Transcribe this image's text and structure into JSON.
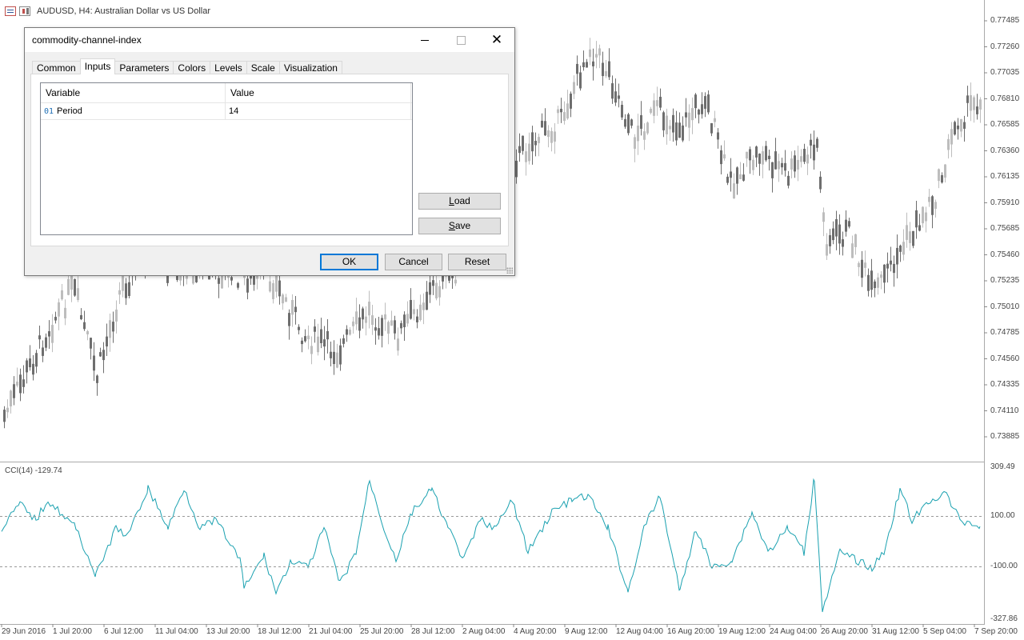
{
  "chart_window": {
    "symbol_title": "AUDUSD, H4:  Australian Dollar vs US Dollar",
    "icons": [
      "chart-window-icon",
      "candles-icon"
    ]
  },
  "indicator_window": {
    "label": "CCI(14) -129.74",
    "line_color": "#1aa1b0"
  },
  "price_axis": [
    "0.77485",
    "0.77260",
    "0.77035",
    "0.76810",
    "0.76585",
    "0.76360",
    "0.76135",
    "0.75910",
    "0.75685",
    "0.75460",
    "0.75235",
    "0.75010",
    "0.74785",
    "0.74560",
    "0.74335",
    "0.74110",
    "0.73885"
  ],
  "cci_axis": [
    "309.49",
    "100.00",
    "-100.00",
    "-327.86"
  ],
  "time_axis": [
    "29 Jun 2016",
    "1 Jul 20:00",
    "6 Jul 12:00",
    "11 Jul 04:00",
    "13 Jul 20:00",
    "18 Jul 12:00",
    "21 Jul 04:00",
    "25 Jul 20:00",
    "28 Jul 12:00",
    "2 Aug 04:00",
    "4 Aug 20:00",
    "9 Aug 12:00",
    "12 Aug 04:00",
    "16 Aug 20:00",
    "19 Aug 12:00",
    "24 Aug 04:00",
    "26 Aug 20:00",
    "31 Aug 12:00",
    "5 Sep 04:00",
    "7 Sep 20:00"
  ],
  "dialog": {
    "title": "commodity-channel-index",
    "tabs": [
      {
        "label": "Common",
        "active": false
      },
      {
        "label": "Inputs",
        "active": true
      },
      {
        "label": "Parameters",
        "active": false
      },
      {
        "label": "Colors",
        "active": false
      },
      {
        "label": "Levels",
        "active": false
      },
      {
        "label": "Scale",
        "active": false
      },
      {
        "label": "Visualization",
        "active": false
      }
    ],
    "grid": {
      "headers": [
        "Variable",
        "Value"
      ],
      "rows": [
        {
          "icon": "01",
          "variable": "Period",
          "value": "14"
        }
      ]
    },
    "buttons": {
      "load": {
        "first": "L",
        "rest": "oad"
      },
      "save": {
        "first": "S",
        "rest": "ave"
      },
      "ok": "OK",
      "cancel": "Cancel",
      "reset": "Reset"
    }
  }
}
